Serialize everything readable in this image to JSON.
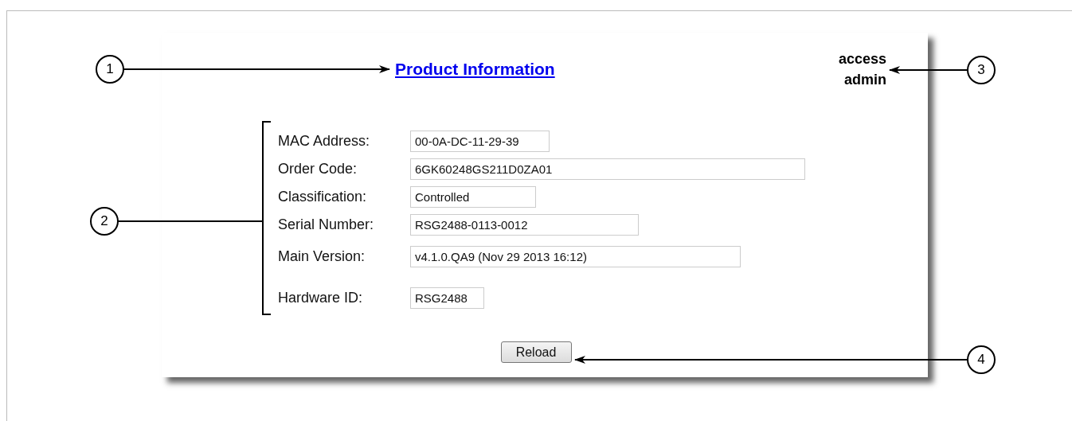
{
  "page": {
    "title": "Product Information",
    "access_label": "access",
    "access_level": "admin"
  },
  "fields": [
    {
      "label": "MAC Address:",
      "value": "00-0A-DC-11-29-39"
    },
    {
      "label": "Order Code:",
      "value": "6GK60248GS211D0ZA01"
    },
    {
      "label": "Classification:",
      "value": "Controlled"
    },
    {
      "label": "Serial Number:",
      "value": "RSG2488-0113-0012"
    },
    {
      "label": "Main Version:",
      "value": "v4.1.0.QA9 (Nov 29 2013 16:12)"
    },
    {
      "label": "Hardware ID:",
      "value": "RSG2488"
    }
  ],
  "buttons": [
    {
      "label": "Reload"
    }
  ],
  "callouts": [
    {
      "number": "1"
    },
    {
      "number": "2"
    },
    {
      "number": "3"
    },
    {
      "number": "4"
    }
  ]
}
